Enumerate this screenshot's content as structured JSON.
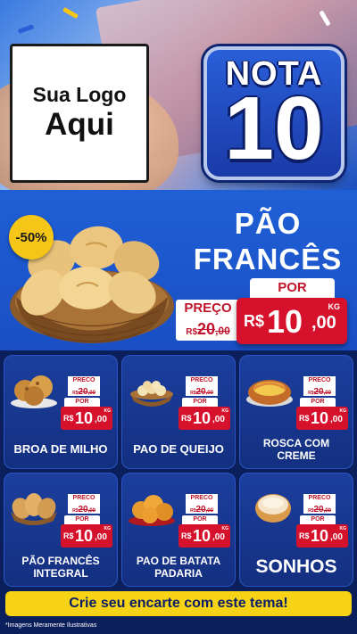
{
  "header": {
    "logo_line1": "Sua Logo",
    "logo_line2": "Aqui",
    "badge_word": "NOTA",
    "badge_number": "10"
  },
  "hero": {
    "discount": "-50%",
    "title_line1": "PÃO",
    "title_line2": "FRANCÊS",
    "preco_label": "PREÇO",
    "old_currency": "R$",
    "old_price": "20",
    "old_cents": ",00",
    "por_label": "POR",
    "new_currency": "R$",
    "new_price": "10",
    "new_cents": ",00",
    "unit": "KG"
  },
  "products": [
    {
      "name": "BROA DE MILHO",
      "preco_label": "PRECO",
      "old_currency": "R$",
      "old_price": "20",
      "old_cents": ",00",
      "por_label": "POR",
      "new_currency": "R$",
      "new_price": "10",
      "new_cents": ",00",
      "unit": "KG"
    },
    {
      "name": "PAO DE QUEIJO",
      "preco_label": "PRECO",
      "old_currency": "R$",
      "old_price": "20",
      "old_cents": ",00",
      "por_label": "POR",
      "new_currency": "R$",
      "new_price": "10",
      "new_cents": ",00",
      "unit": "KG"
    },
    {
      "name": "ROSCA COM CREME",
      "preco_label": "PRECO",
      "old_currency": "R$",
      "old_price": "20",
      "old_cents": ",00",
      "por_label": "POR",
      "new_currency": "R$",
      "new_price": "10",
      "new_cents": ",00",
      "unit": "KG"
    },
    {
      "name": "PÃO FRANCÊS INTEGRAL",
      "preco_label": "PRECO",
      "old_currency": "R$",
      "old_price": "20",
      "old_cents": ",00",
      "por_label": "POR",
      "new_currency": "R$",
      "new_price": "10",
      "new_cents": ",00",
      "unit": "KG"
    },
    {
      "name": "PAO DE BATATA PADARIA",
      "preco_label": "PRECO",
      "old_currency": "R$",
      "old_price": "20",
      "old_cents": ",00",
      "por_label": "POR",
      "new_currency": "R$",
      "new_price": "10",
      "new_cents": ",00",
      "unit": "KG"
    },
    {
      "name": "SONHOS",
      "preco_label": "PRECO",
      "old_currency": "R$",
      "old_price": "20",
      "old_cents": ",00",
      "por_label": "POR",
      "new_currency": "R$",
      "new_price": "10",
      "new_cents": ",00",
      "unit": "KG"
    }
  ],
  "cta": {
    "label": "Crie seu encarte com este tema!"
  },
  "footer": {
    "disclaimer": "*Imagens Meramente Ilustrativas"
  },
  "icons": {
    "hero": "bread-basket-icon",
    "products": [
      "corn-bread-icon",
      "cheese-bread-icon",
      "cream-pastry-icon",
      "whole-wheat-rolls-icon",
      "potato-bread-icon",
      "donut-icon"
    ]
  },
  "colors": {
    "brand_blue": "#1f5fd6",
    "dark_blue": "#0a1f5c",
    "price_red": "#d6112c",
    "cta_yellow": "#f7d316",
    "badge_yellow": "#f5c518"
  }
}
